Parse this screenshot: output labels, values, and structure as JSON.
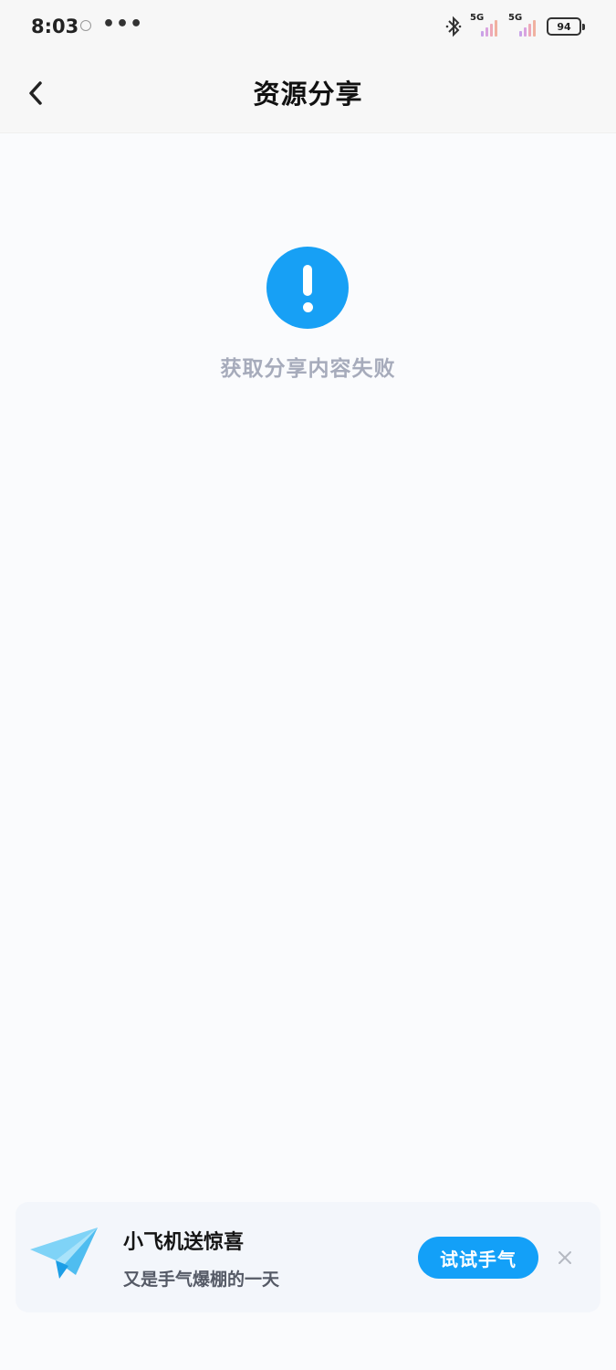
{
  "status_bar": {
    "time": "8:03",
    "more": "•••",
    "signal1_label": "5G",
    "signal2_label": "5G",
    "battery": "94",
    "icons": [
      "notification-icon",
      "bluetooth-icon",
      "signal-icon",
      "battery-icon"
    ]
  },
  "header": {
    "title": "资源分享",
    "back_icon": "chevron-left-icon"
  },
  "empty_state": {
    "icon": "exclamation-circle-icon",
    "message": "获取分享内容失败",
    "accent": "#17a0f5"
  },
  "promo": {
    "icon": "paper-plane-icon",
    "title": "小飞机送惊喜",
    "subtitle": "又是手气爆棚的一天",
    "button_label": "试试手气",
    "close_icon": "close-icon",
    "button_color": "#13a0f8"
  }
}
